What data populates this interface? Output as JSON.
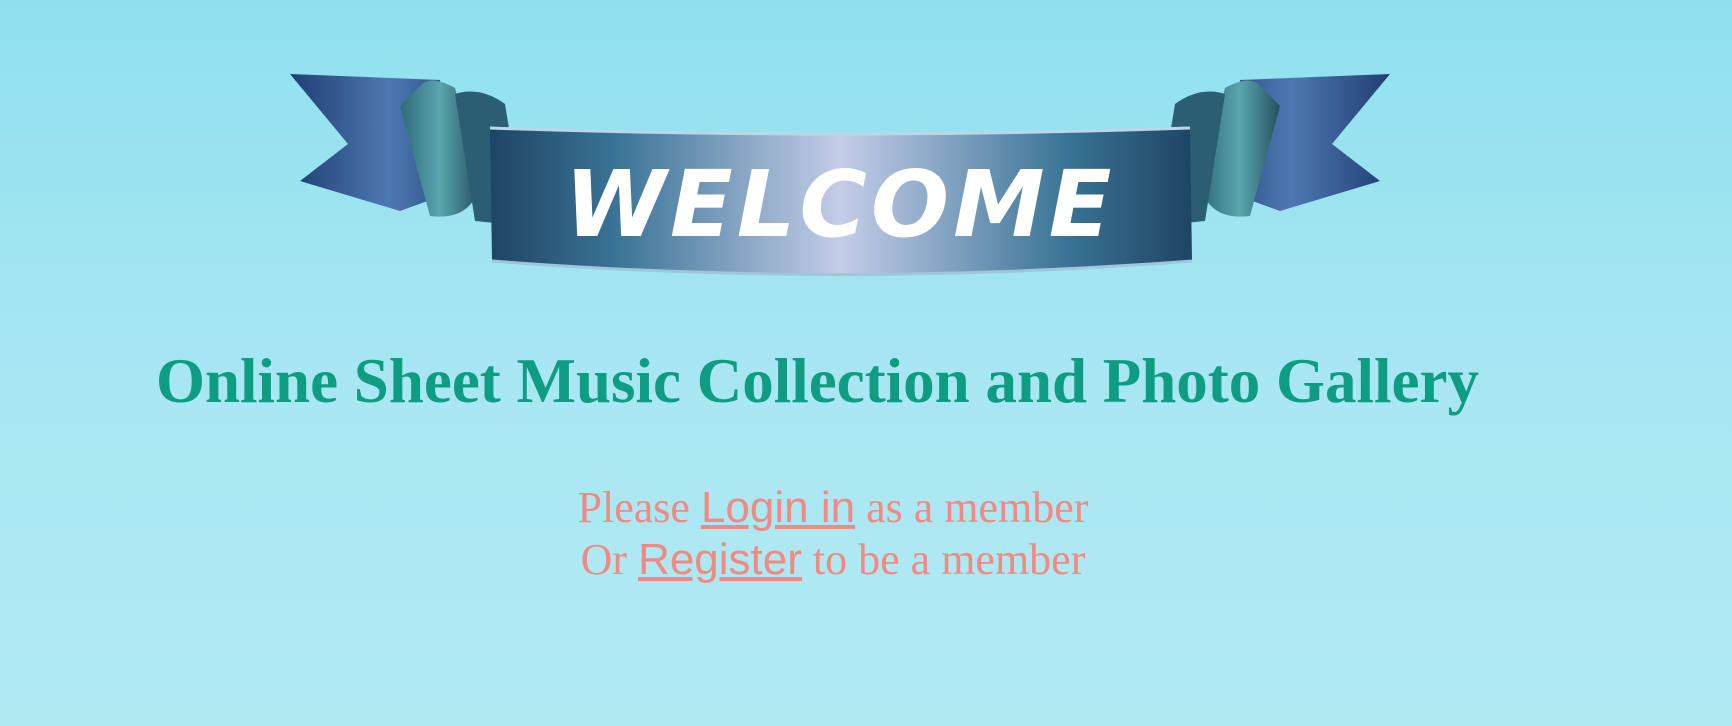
{
  "banner": {
    "text": "WELCOME"
  },
  "headline": {
    "text": "Online Sheet Music Collection and Photo Gallery"
  },
  "login_line": {
    "prefix": "Please",
    "link": "Login in",
    "suffix": "as a member"
  },
  "register_line": {
    "prefix": "Or",
    "link": "Register",
    "suffix": "to be a member"
  },
  "colors": {
    "background": "#a9e7f2",
    "headline": "#0e9c82",
    "member_text": "#f08a82",
    "ribbon": "#2f5a82"
  }
}
